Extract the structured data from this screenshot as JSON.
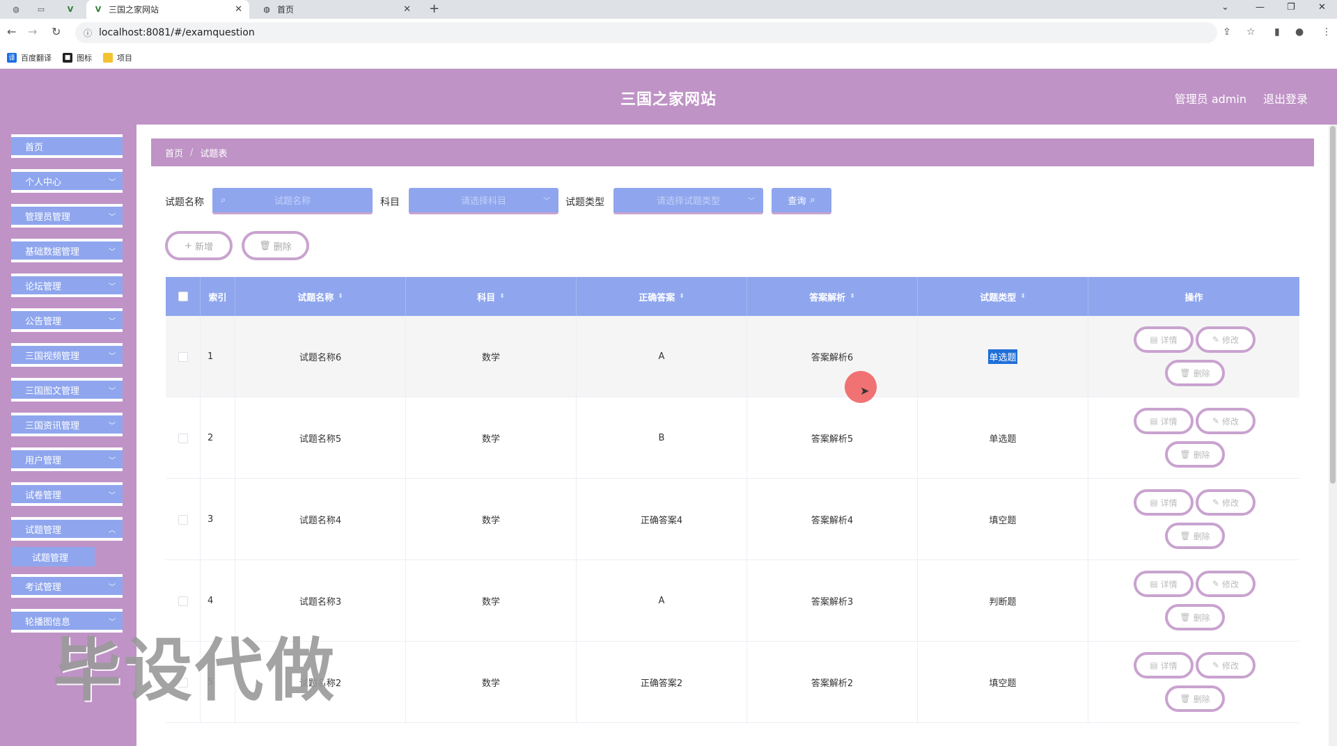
{
  "browser": {
    "tabs": [
      {
        "title": "三国之家网站",
        "active": true
      },
      {
        "title": "首页",
        "active": false
      }
    ],
    "new_tab": "+",
    "url": "localhost:8081/#/examquestion",
    "bookmarks": [
      {
        "label": "百度翻译",
        "icon": "translate-icon",
        "color": "#1e6fe0",
        "glyph": "译"
      },
      {
        "label": "图标",
        "icon": "picture-icon",
        "color": "#222222",
        "glyph": "■"
      },
      {
        "label": "项目",
        "icon": "folder-icon",
        "color": "#f2c230",
        "glyph": ""
      }
    ]
  },
  "header": {
    "title": "三国之家网站",
    "user": "管理员 admin",
    "logout": "退出登录"
  },
  "sidebar": {
    "items": [
      {
        "label": "首页",
        "has_chevron": false
      },
      {
        "label": "个人中心",
        "has_chevron": true
      },
      {
        "label": "管理员管理",
        "has_chevron": true
      },
      {
        "label": "基础数据管理",
        "has_chevron": true
      },
      {
        "label": "论坛管理",
        "has_chevron": true
      },
      {
        "label": "公告管理",
        "has_chevron": true
      },
      {
        "label": "三国视频管理",
        "has_chevron": true
      },
      {
        "label": "三国图文管理",
        "has_chevron": true
      },
      {
        "label": "三国资讯管理",
        "has_chevron": true
      },
      {
        "label": "用户管理",
        "has_chevron": true
      },
      {
        "label": "试卷管理",
        "has_chevron": true
      },
      {
        "label": "试题管理",
        "has_chevron": true
      },
      {
        "label": "考试管理",
        "has_chevron": true
      },
      {
        "label": "轮播图信息",
        "has_chevron": true
      }
    ],
    "sub_item": "试题管理"
  },
  "breadcrumb": {
    "home": "首页",
    "separator": "/",
    "current": "试题表"
  },
  "filters": {
    "name_label": "试题名称",
    "name_placeholder": "试题名称",
    "subject_label": "科目",
    "subject_placeholder": "请选择科目",
    "type_label": "试题类型",
    "type_placeholder": "请选择试题类型",
    "query": "查询"
  },
  "actions": {
    "add": "新增",
    "delete": "删除"
  },
  "table": {
    "columns": [
      "索引",
      "试题名称",
      "科目",
      "正确答案",
      "答案解析",
      "试题类型",
      "操作"
    ],
    "row_buttons": {
      "detail": "详情",
      "edit": "修改",
      "delete": "删除"
    },
    "rows": [
      {
        "index": "1",
        "name": "试题名称6",
        "subject": "数学",
        "answer": "A",
        "analysis": "答案解析6",
        "type": "单选题",
        "highlight": true
      },
      {
        "index": "2",
        "name": "试题名称5",
        "subject": "数学",
        "answer": "B",
        "analysis": "答案解析5",
        "type": "单选题",
        "highlight": false
      },
      {
        "index": "3",
        "name": "试题名称4",
        "subject": "数学",
        "answer": "正确答案4",
        "analysis": "答案解析4",
        "type": "填空题",
        "highlight": false
      },
      {
        "index": "4",
        "name": "试题名称3",
        "subject": "数学",
        "answer": "A",
        "analysis": "答案解析3",
        "type": "判断题",
        "highlight": false
      },
      {
        "index": "5",
        "name": "试题名称2",
        "subject": "数学",
        "answer": "正确答案2",
        "analysis": "答案解析2",
        "type": "填空题",
        "highlight": false
      }
    ]
  },
  "watermark": "毕设代做"
}
